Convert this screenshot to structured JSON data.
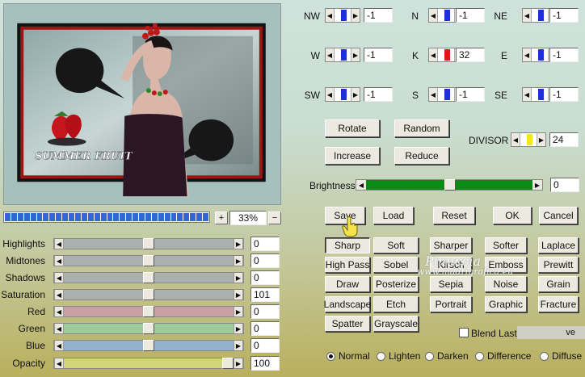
{
  "preview": {
    "artwork_text": "SUMMER FRUIT"
  },
  "progress": {
    "segments": 32
  },
  "zoom": {
    "plus": "+",
    "value": "33%",
    "minus": "−"
  },
  "sliders": [
    {
      "label": "Highlights",
      "value": "0",
      "fraction": 0.5,
      "color": "#a9b0ae"
    },
    {
      "label": "Midtones",
      "value": "0",
      "fraction": 0.5,
      "color": "#a9b0ae"
    },
    {
      "label": "Shadows",
      "value": "0",
      "fraction": 0.5,
      "color": "#a9b0ae"
    },
    {
      "label": "Saturation",
      "value": "101",
      "fraction": 0.5,
      "color": "#a9b0ae"
    },
    {
      "label": "Red",
      "value": "0",
      "fraction": 0.5,
      "color": "#c9a1a4"
    },
    {
      "label": "Green",
      "value": "0",
      "fraction": 0.5,
      "color": "#9ccc9a"
    },
    {
      "label": "Blue",
      "value": "0",
      "fraction": 0.5,
      "color": "#93b2cc"
    },
    {
      "label": "Opacity",
      "value": "100",
      "fraction": 1.0,
      "color": "#d2d47a"
    }
  ],
  "matrix": [
    {
      "label": "NW",
      "value": "-1",
      "marker": "#1d2fd6"
    },
    {
      "label": "N",
      "value": "-1",
      "marker": "#1d2fd6"
    },
    {
      "label": "NE",
      "value": "-1",
      "marker": "#1d2fd6"
    },
    {
      "label": "W",
      "value": "-1",
      "marker": "#1d2fd6"
    },
    {
      "label": "K",
      "value": "32",
      "marker": "#e01818"
    },
    {
      "label": "E",
      "value": "-1",
      "marker": "#1d2fd6"
    },
    {
      "label": "SW",
      "value": "-1",
      "marker": "#1d2fd6"
    },
    {
      "label": "S",
      "value": "-1",
      "marker": "#1d2fd6"
    },
    {
      "label": "SE",
      "value": "-1",
      "marker": "#1d2fd6"
    }
  ],
  "ops": {
    "rotate": "Rotate",
    "random": "Random",
    "increase": "Increase",
    "reduce": "Reduce"
  },
  "divisor": {
    "label": "DIVISOR",
    "value": "24",
    "marker": "#f2e81a"
  },
  "brightness": {
    "label": "Brightness",
    "value": "0",
    "fraction": 0.5
  },
  "actions": {
    "save": "Save",
    "load": "Load",
    "reset": "Reset",
    "ok": "OK",
    "cancel": "Cancel"
  },
  "presets": [
    "Sharp",
    "Soft",
    "Sharper",
    "Softer",
    "Laplace",
    "High Pass",
    "Sobel",
    "Kirsch",
    "Emboss",
    "Prewitt",
    "Draw",
    "Posterize",
    "Sepia",
    "Noise",
    "Grain",
    "Landscape",
    "Etch",
    "Portrait",
    "Graphic",
    "Fracture",
    "Spatter",
    "Grayscale"
  ],
  "blend_last": {
    "label": "Blend Last",
    "checked": false,
    "trailing": "ve"
  },
  "blend_modes": [
    {
      "label": "Normal",
      "checked": true
    },
    {
      "label": "Lighten",
      "checked": false
    },
    {
      "label": "Darken",
      "checked": false
    },
    {
      "label": "Difference",
      "checked": false
    },
    {
      "label": "Diffuse",
      "checked": false
    }
  ],
  "watermark": {
    "line1": "Pinuccia",
    "line2": "www.madrigrafica.eu"
  }
}
